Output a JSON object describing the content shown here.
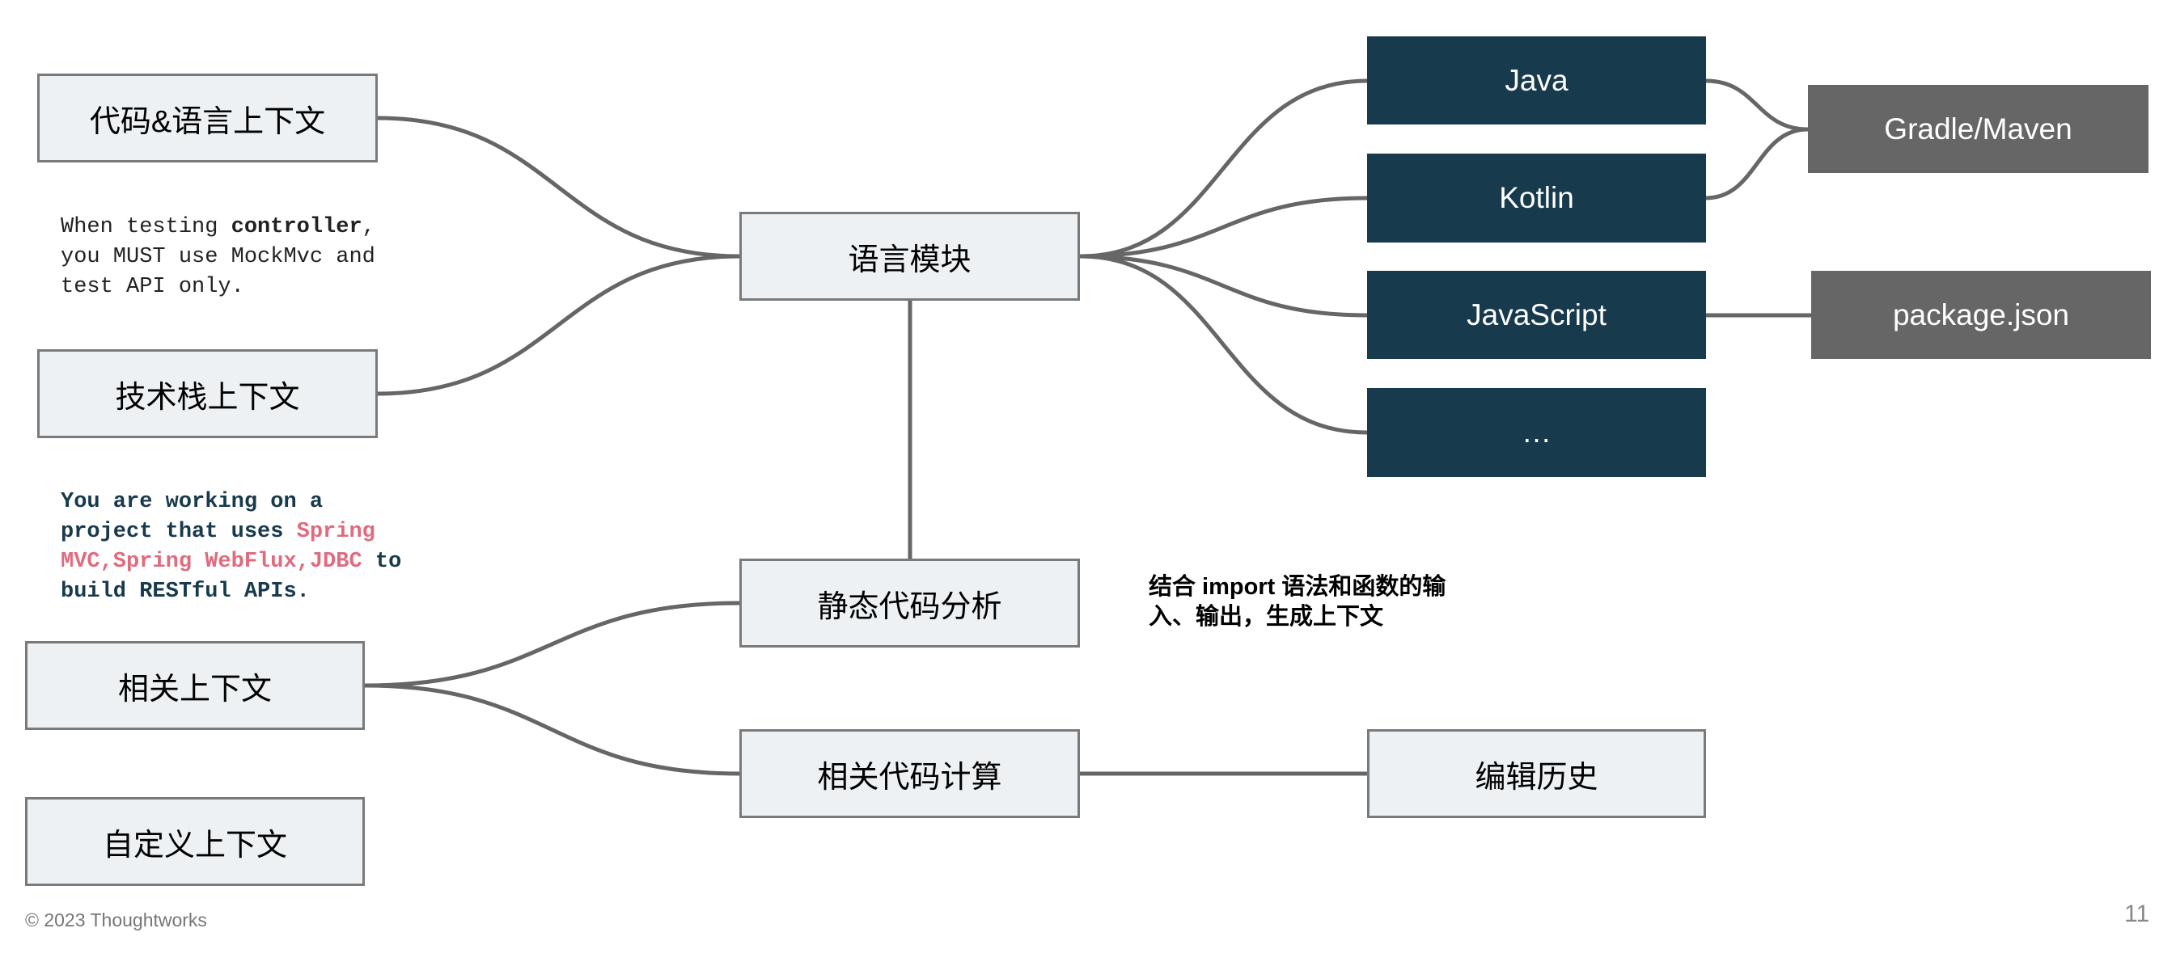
{
  "nodes": {
    "code_lang_context": "代码&语言上下文",
    "tech_stack_context": "技术栈上下文",
    "related_context": "相关上下文",
    "custom_context": "自定义上下文",
    "language_module": "语言模块",
    "static_analysis": "静态代码分析",
    "related_code_calc": "相关代码计算",
    "java": "Java",
    "kotlin": "Kotlin",
    "javascript": "JavaScript",
    "more": "…",
    "gradle_maven": "Gradle/Maven",
    "package_json": "package.json",
    "edit_history": "编辑历史"
  },
  "snippets": {
    "controller": {
      "part1": "When testing ",
      "bold": "controller",
      "part2": ",\nyou MUST use MockMvc and\ntest API only."
    },
    "tech_stack": {
      "part1": "You are working on a\nproject that uses ",
      "highlight": "Spring\nMVC,Spring WebFlux,JDBC",
      "part2": " to\nbuild RESTful APIs."
    }
  },
  "annotation": "结合 import 语法和函数的输入、输出，生成上下文",
  "footer": {
    "copyright": "© 2023 Thoughtworks",
    "page_number": "11"
  },
  "colors": {
    "light_box": "#edf1f4",
    "dark_box": "#173a4c",
    "gray_box": "#666666",
    "connector": "#666666",
    "code_blue": "#173a4c",
    "code_pink": "#e06b80"
  }
}
